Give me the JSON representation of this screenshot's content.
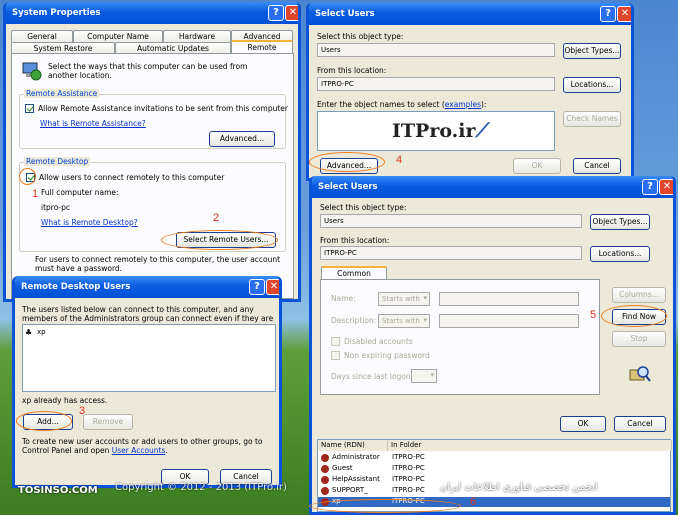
{
  "system_properties": {
    "title": "System Properties",
    "tabs_row1": [
      "General",
      "Computer Name",
      "Hardware",
      "Advanced"
    ],
    "tabs_row2": [
      "System Restore",
      "Automatic Updates",
      "Remote"
    ],
    "intro": "Select the ways that this computer can be used from another location.",
    "remote_assistance": {
      "title": "Remote Assistance",
      "checkbox": "Allow Remote Assistance invitations to be sent from this computer",
      "link": "What is Remote Assistance?",
      "advanced_button": "Advanced..."
    },
    "remote_desktop": {
      "title": "Remote Desktop",
      "checkbox": "Allow users to connect remotely to this computer",
      "computer_name_label": "Full computer name:",
      "computer_name": "itpro-pc",
      "link": "What is Remote Desktop?",
      "select_users_button": "Select Remote Users...",
      "note": "For users to connect remotely to this computer, the user account must have a password."
    }
  },
  "remote_desktop_users": {
    "title": "Remote Desktop Users",
    "description": "The users listed below can connect to this computer, and any members of the Administrators group can connect even if they are not listed.",
    "users": [
      "xp"
    ],
    "access_text": "xp already has access.",
    "add_button": "Add...",
    "remove_button": "Remove",
    "footer_text_prefix": "To create new user accounts or add users to other groups, go to Control Panel and open ",
    "footer_link": "User Accounts",
    "footer_text_suffix": ".",
    "ok_button": "OK",
    "cancel_button": "Cancel"
  },
  "select_users_1": {
    "title": "Select Users",
    "object_type_label": "Select this object type:",
    "object_type_value": "Users",
    "object_types_button": "Object Types...",
    "location_label": "From this location:",
    "location_value": "ITPRO-PC",
    "locations_button": "Locations...",
    "enter_names_label": "Enter the object names to select (",
    "examples_link": "examples",
    "enter_names_suffix": "):",
    "check_names_button": "Check Names",
    "logo_text": "ITPro.ir",
    "advanced_button": "Advanced...",
    "ok_button": "OK",
    "cancel_button": "Cancel"
  },
  "select_users_2": {
    "title": "Select Users",
    "object_type_label": "Select this object type:",
    "object_type_value": "Users",
    "object_types_button": "Object Types...",
    "location_label": "From this location:",
    "location_value": "ITPRO-PC",
    "locations_button": "Locations...",
    "tab": "Common Queries",
    "name_label": "Name:",
    "name_mode": "Starts with",
    "description_label": "Description:",
    "description_mode": "Starts with",
    "disabled_accounts": "Disabled accounts",
    "non_expiring": "Non expiring password",
    "days_label": "Days since last logon:",
    "columns_button": "Columns...",
    "find_now_button": "Find Now",
    "stop_button": "Stop",
    "ok_button": "OK",
    "cancel_button": "Cancel",
    "col_name": "Name (RDN)",
    "col_folder": "In Folder",
    "results": [
      {
        "name": "Administrator",
        "folder": "ITPRO-PC"
      },
      {
        "name": "Guest",
        "folder": "ITPRO-PC"
      },
      {
        "name": "HelpAssistant",
        "folder": "ITPRO-PC"
      },
      {
        "name": "SUPPORT_",
        "folder": "ITPRO-PC"
      },
      {
        "name": "xp",
        "folder": "ITPRO-PC"
      }
    ]
  },
  "annotations": [
    "1",
    "2",
    "3",
    "4",
    "5",
    "6"
  ],
  "watermarks": {
    "left": "TOSINSO.COM",
    "center": "Copyright © 2012 - 2013  (ITPro.ir)",
    "right": "انجمن تخصصی فناوری اطلاعات ایران"
  }
}
